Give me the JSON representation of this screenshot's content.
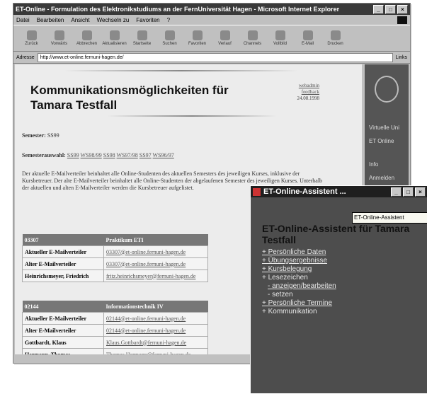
{
  "browser": {
    "title": "ET-Online - Formulation des Elektronikstudiums an der FernUniversität Hagen - Microsoft Internet Explorer",
    "menu": [
      "Datei",
      "Bearbeiten",
      "Ansicht",
      "Wechseln zu",
      "Favoriten",
      "?"
    ],
    "toolbar": [
      "Zurück",
      "Vorwärts",
      "Abbrechen",
      "Aktualisieren",
      "Startseite",
      "Suchen",
      "Favoriten",
      "Verlauf",
      "Channels",
      "Vollbild",
      "E-Mail",
      "Drucken"
    ],
    "address_label": "Adresse",
    "address": "http://www.et-online.fernuni-hagen.de/",
    "links_label": "Links"
  },
  "page": {
    "title": "Kommunikationsmöglichkeiten für Tamara Testfall",
    "info": [
      "webadmin",
      "feedback",
      "24.08.1998"
    ],
    "semester_label": "Semester:",
    "semester_value": "SS99",
    "semesterwahl_label": "Semesterauswahl:",
    "semesterwahl_links": [
      "SS99",
      "WS98/99",
      "SS98",
      "WS97/98",
      "SS97",
      "WS96/97"
    ],
    "description": "Der aktuelle E-Mailverteiler beinhaltet alle Online-Studenten des aktuellen Semesters des jeweiligen Kurses, inklusive der Kursbetreuer. Der alte E-Mailverteiler beinhaltet alle Online-Studenten der abgelaufenen Semester des jeweiligen Kurses. Unterhalb der aktuellen und alten E-Mailverteiler werden die Kursbetreuer aufgelistet."
  },
  "sidebar": {
    "items": [
      "Virtuelle Uni",
      "ET Online",
      "Info",
      "Anmelden"
    ]
  },
  "tables": [
    {
      "header": [
        "03307",
        "Praktikum ETI"
      ],
      "rows": [
        [
          "Aktueller E-Mailverteiler",
          "03307@et-online.fernuni-hagen.de"
        ],
        [
          "Alter E-Mailverteiler",
          "03307@et-online.fernuni-hagen.de"
        ],
        [
          "Heinrichsmeyer, Friedrich",
          "fritz.heinrichsmeyer@fernuni-hagen.de"
        ]
      ]
    },
    {
      "header": [
        "02144",
        "Informationstechnik IV"
      ],
      "rows": [
        [
          "Aktueller E-Mailverteiler",
          "02144@et-online.fernuni-hagen.de"
        ],
        [
          "Alter E-Mailverteiler",
          "02144@et-online.fernuni-hagen.de"
        ],
        [
          "Gottbardt, Klaus",
          "Klaus.Gottbardt@fernuni-hagen.de"
        ],
        [
          "Hermann, Thomas",
          "Thomas.Hermann@fernuni-hagen.de"
        ]
      ]
    }
  ],
  "popup": {
    "title": "ET-Online-Assistent ...",
    "tooltip": "ET-Online-Assistent",
    "heading": "ET-Online-Assistent für Tamara Testfall",
    "items": [
      {
        "text": "+ Persönliche Daten",
        "link": true,
        "sub": false
      },
      {
        "text": "+ Übungsergebnisse",
        "link": true,
        "sub": false
      },
      {
        "text": "+ Kursbelegung",
        "link": true,
        "sub": false
      },
      {
        "text": "+ Lesezeichen",
        "link": false,
        "sub": false
      },
      {
        "text": "- anzeigen/bearbeiten",
        "link": true,
        "sub": true
      },
      {
        "text": "- setzen",
        "link": false,
        "sub": true
      },
      {
        "text": "+ Persönliche Termine",
        "link": true,
        "sub": false
      },
      {
        "text": "+ Kommunikation",
        "link": false,
        "sub": false
      }
    ]
  }
}
